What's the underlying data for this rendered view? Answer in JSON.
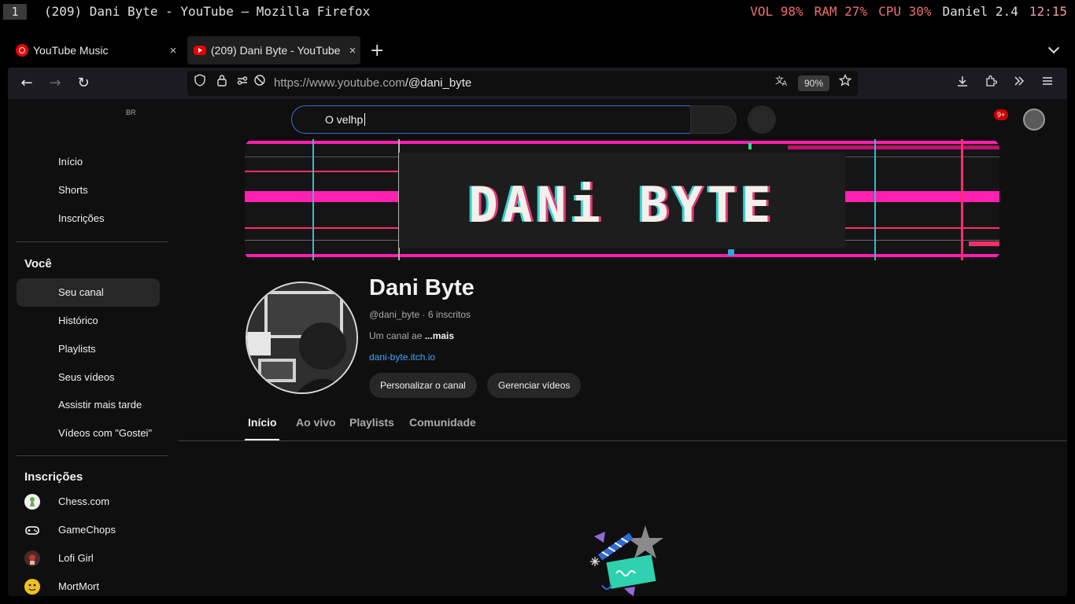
{
  "wm": {
    "workspace": "1",
    "window_title": "(209) Dani Byte - YouTube — Mozilla Firefox",
    "vol": "VOL 98%",
    "ram": "RAM 27%",
    "cpu": "CPU 30%",
    "user": "Daniel 2.4",
    "clock": "12:15"
  },
  "tabs": [
    {
      "label": "YouTube Music",
      "close": "×"
    },
    {
      "label": "(209) Dani Byte - YouTube",
      "close": "×"
    }
  ],
  "newtab": "+",
  "nav": {
    "back": "←",
    "forward": "→",
    "reload": "↻",
    "url_host": "https://www.youtube.com",
    "url_path": "/@dani_byte",
    "zoom": "90%"
  },
  "yt": {
    "region": "BR",
    "search_value": "O velhp",
    "notifications": "9+",
    "sidebar_main": [
      "Início",
      "Shorts",
      "Inscrições"
    ],
    "you_heading": "Você",
    "sidebar_you": [
      "Seu canal",
      "Histórico",
      "Playlists",
      "Seus vídeos",
      "Assistir mais tarde",
      "Vídeos com \"Gostei\""
    ],
    "subs_heading": "Inscrições",
    "subscriptions": [
      "Chess.com",
      "GameChops",
      "Lofi Girl",
      "MortMort"
    ],
    "banner_text": "DANi BYTE",
    "channel": {
      "name": "Dani Byte",
      "meta": "@dani_byte · 6 inscritos",
      "desc": "Um canal ae ",
      "more": "...mais",
      "link": "dani-byte.itch.io",
      "btn_customize": "Personalizar o canal",
      "btn_manage": "Gerenciar vídeos"
    },
    "channel_tabs": [
      "Início",
      "Ao vivo",
      "Playlists",
      "Comunidade"
    ]
  }
}
